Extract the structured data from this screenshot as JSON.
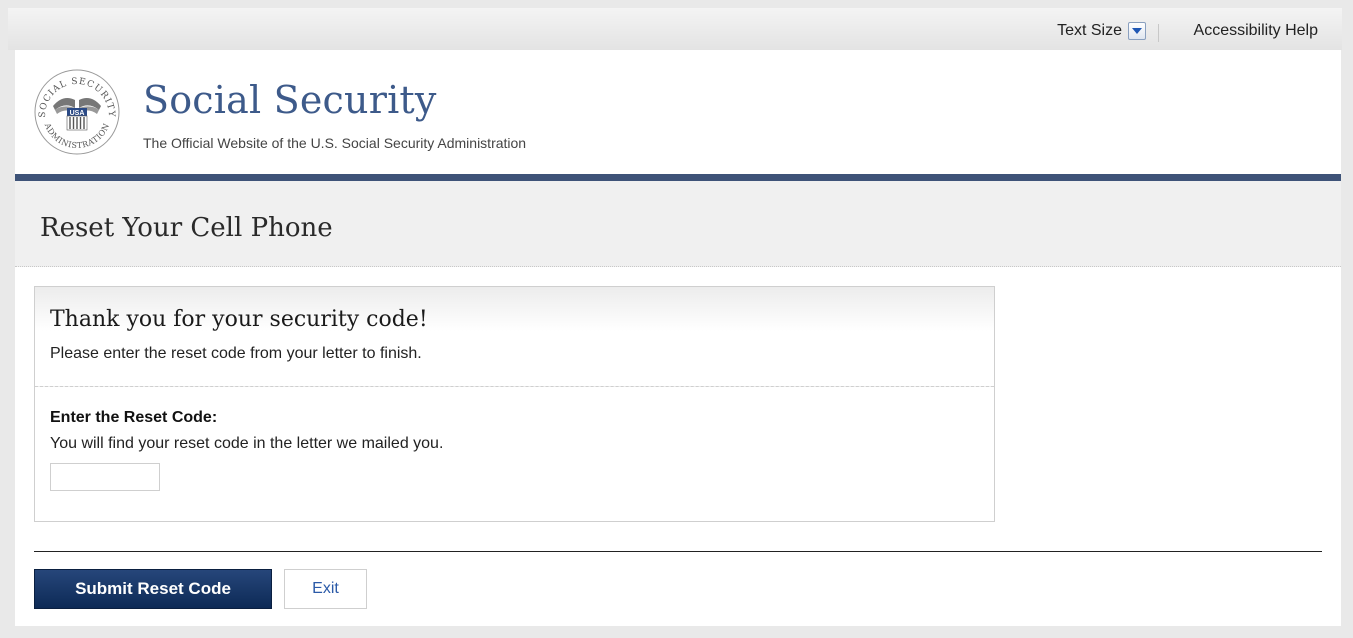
{
  "utility": {
    "text_size_label": "Text Size",
    "accessibility_help_label": "Accessibility Help"
  },
  "brand": {
    "title": "Social Security",
    "subtitle": "The Official Website of the U.S. Social Security Administration",
    "seal": {
      "top_text": "SOCIAL SECURITY",
      "bottom_text": "ADMINISTRATION",
      "center_text": "USA"
    }
  },
  "page": {
    "title": "Reset Your Cell Phone"
  },
  "panel": {
    "heading": "Thank you for your security code!",
    "subheading": "Please enter the reset code from your letter to finish.",
    "field_label": "Enter the Reset Code:",
    "field_help": "You will find your reset code in the letter we mailed you.",
    "field_value": ""
  },
  "actions": {
    "submit_label": "Submit Reset Code",
    "exit_label": "Exit"
  },
  "colors": {
    "brand_blue": "#3d5a8a",
    "nav_rule": "#3e5378",
    "button_navy": "#0d2a56",
    "link_blue": "#2b5aa8"
  }
}
